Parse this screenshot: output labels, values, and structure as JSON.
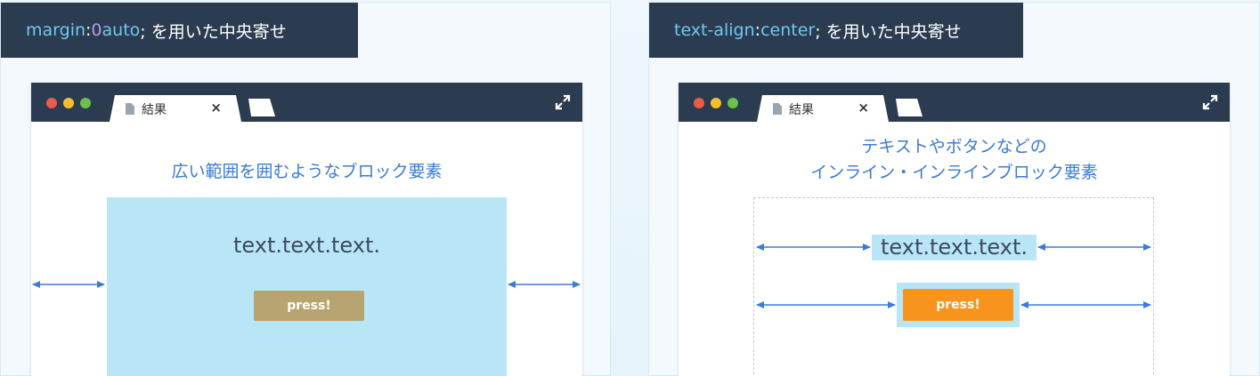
{
  "left": {
    "label": {
      "prop": "margin",
      "sep": ": ",
      "num": "0",
      "val": " auto",
      "suffix": "; を用いた中央寄せ"
    },
    "tab_title": "結果",
    "tab_close": "×",
    "heading": "広い範囲を囲むようなブロック要素",
    "block_text": "text.text.text.",
    "button": "press!"
  },
  "right": {
    "label": {
      "prop": "text-align",
      "sep": ": ",
      "val": "center",
      "suffix": "; を用いた中央寄せ"
    },
    "tab_title": "結果",
    "tab_close": "×",
    "heading_line1": "テキストやボタンなどの",
    "heading_line2": "インライン・インラインブロック要素",
    "inline_text": "text.text.text.",
    "button": "press!"
  },
  "colors": {
    "dark": "#2c3c50",
    "accent_blue": "#3a7bd5",
    "light_blue_block": "#b9e6f7",
    "orange": "#f7941d",
    "muted_tan": "#b8a471"
  },
  "icons": [
    "document-icon",
    "close-icon",
    "expand-icon",
    "double-arrow-icon"
  ]
}
